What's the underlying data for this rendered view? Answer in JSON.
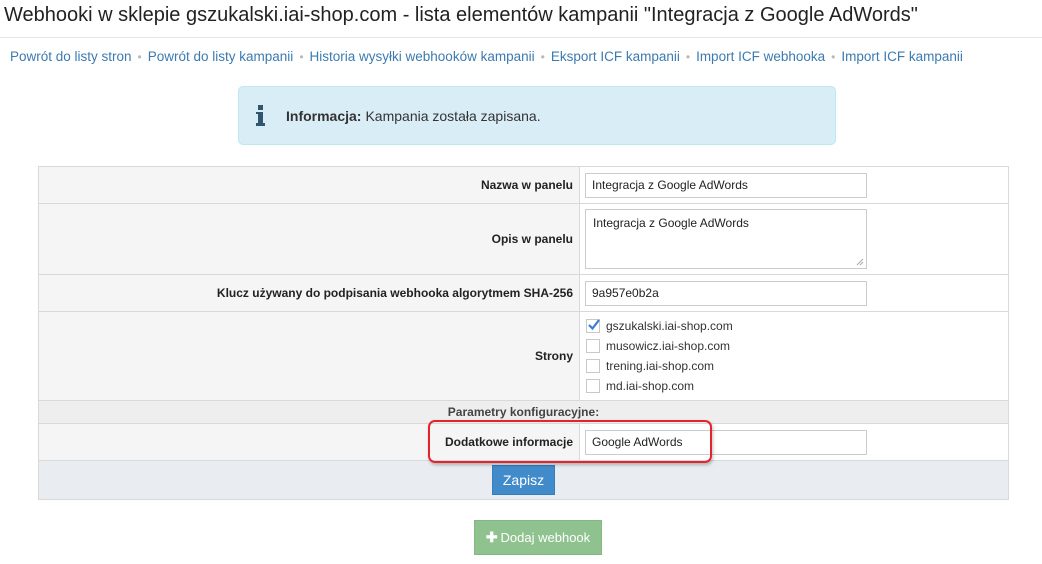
{
  "page": {
    "title": "Webhooki w sklepie gszukalski.iai-shop.com - lista elementów kampanii \"Integracja z Google AdWords\""
  },
  "breadcrumb": [
    {
      "label": "Powrót do listy stron"
    },
    {
      "label": "Powrót do listy kampanii"
    },
    {
      "label": "Historia wysyłki webhooków kampanii"
    },
    {
      "label": "Eksport ICF kampanii"
    },
    {
      "label": "Import ICF webhooka"
    },
    {
      "label": "Import ICF kampanii"
    }
  ],
  "breadcrumb_separator": "•",
  "info": {
    "icon": "info-icon",
    "heading": "Informacja:",
    "message": "Kampania została zapisana."
  },
  "form": {
    "name": {
      "label": "Nazwa w panelu",
      "value": "Integracja z Google AdWords"
    },
    "description": {
      "label": "Opis w panelu",
      "value": "Integracja z Google AdWords"
    },
    "key": {
      "label": "Klucz używany do podpisania webhooka algorytmem SHA-256",
      "value": "9a957e0b2a"
    },
    "shops": {
      "label": "Strony",
      "options": [
        {
          "label": "gszukalski.iai-shop.com",
          "checked": true
        },
        {
          "label": "musowicz.iai-shop.com",
          "checked": false
        },
        {
          "label": "trening.iai-shop.com",
          "checked": false
        },
        {
          "label": "md.iai-shop.com",
          "checked": false
        }
      ]
    },
    "config_header": "Parametry konfiguracyjne:",
    "extra_info": {
      "label": "Dodatkowe informacje",
      "value": "Google AdWords"
    },
    "save_label": "Zapisz"
  },
  "add_webhook": {
    "label": "Dodaj webhook",
    "icon": "plus-icon"
  },
  "colors": {
    "link": "#3c7ab0",
    "info_bg": "#d9edf7",
    "save_button": "#428bca",
    "add_button": "#8fc28f",
    "highlight": "#e5232d"
  }
}
